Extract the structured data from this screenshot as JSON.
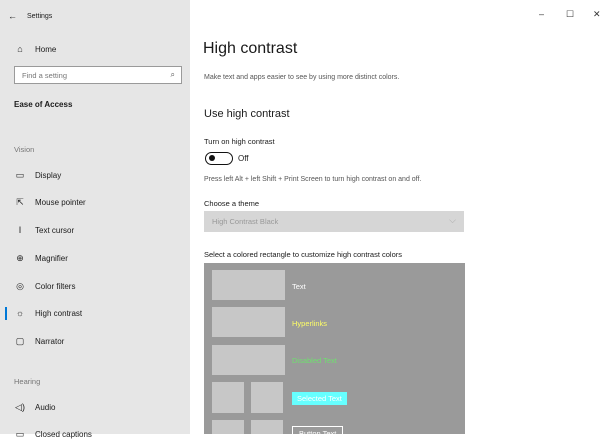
{
  "window": {
    "title": "Settings",
    "controls": {
      "minimize": "–",
      "maximize": "☐",
      "close": "✕"
    }
  },
  "sidebar": {
    "home_label": "Home",
    "search": {
      "placeholder": "Find a setting"
    },
    "category": "Ease of Access",
    "sections": [
      {
        "title": "Vision"
      },
      {
        "title": "Hearing"
      }
    ],
    "items": [
      {
        "label": "Display",
        "icon": "display-icon",
        "glyph": "▭"
      },
      {
        "label": "Mouse pointer",
        "icon": "mouse-pointer-icon",
        "glyph": "⇱"
      },
      {
        "label": "Text cursor",
        "icon": "text-cursor-icon",
        "glyph": "I"
      },
      {
        "label": "Magnifier",
        "icon": "magnifier-icon",
        "glyph": "⊕"
      },
      {
        "label": "Color filters",
        "icon": "color-filters-icon",
        "glyph": "◎"
      },
      {
        "label": "High contrast",
        "icon": "high-contrast-icon",
        "glyph": "☼",
        "selected": true
      },
      {
        "label": "Narrator",
        "icon": "narrator-icon",
        "glyph": "▢"
      },
      {
        "label": "Audio",
        "icon": "audio-icon",
        "glyph": "◁)"
      },
      {
        "label": "Closed captions",
        "icon": "closed-captions-icon",
        "glyph": "▭"
      }
    ]
  },
  "main": {
    "title": "High contrast",
    "description": "Make text and apps easier to see by using more distinct colors.",
    "section_title": "Use high contrast",
    "toggle": {
      "label": "Turn on high contrast",
      "state": "Off"
    },
    "shortcut_hint": "Press left Alt + left Shift + Print Screen to turn high contrast on and off.",
    "theme": {
      "label": "Choose a theme",
      "value": "High Contrast Black"
    },
    "customize_label": "Select a colored rectangle to customize high contrast colors",
    "preview": {
      "text": "Text",
      "hyperlinks": "Hyperlinks",
      "disabled": "Disabled Text",
      "selected": "Selected Text",
      "button": "Button Text"
    }
  },
  "colors": {
    "accent": "#0078d7",
    "hyperlink": "#ffff66",
    "disabled": "#6fe06f",
    "selected_bg": "#66ffff"
  }
}
